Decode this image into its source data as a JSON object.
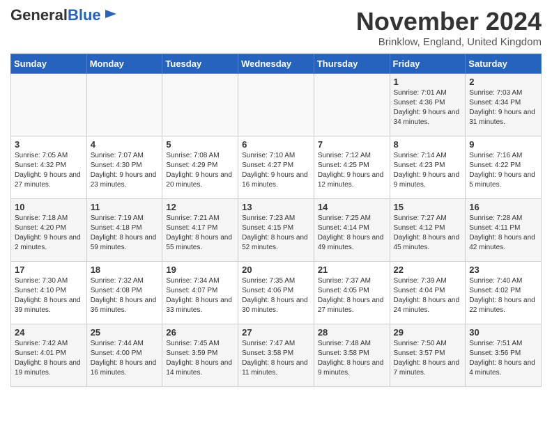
{
  "header": {
    "logo_general": "General",
    "logo_blue": "Blue",
    "month_title": "November 2024",
    "location": "Brinklow, England, United Kingdom"
  },
  "days_of_week": [
    "Sunday",
    "Monday",
    "Tuesday",
    "Wednesday",
    "Thursday",
    "Friday",
    "Saturday"
  ],
  "weeks": [
    [
      {
        "day": "",
        "info": ""
      },
      {
        "day": "",
        "info": ""
      },
      {
        "day": "",
        "info": ""
      },
      {
        "day": "",
        "info": ""
      },
      {
        "day": "",
        "info": ""
      },
      {
        "day": "1",
        "info": "Sunrise: 7:01 AM\nSunset: 4:36 PM\nDaylight: 9 hours and 34 minutes."
      },
      {
        "day": "2",
        "info": "Sunrise: 7:03 AM\nSunset: 4:34 PM\nDaylight: 9 hours and 31 minutes."
      }
    ],
    [
      {
        "day": "3",
        "info": "Sunrise: 7:05 AM\nSunset: 4:32 PM\nDaylight: 9 hours and 27 minutes."
      },
      {
        "day": "4",
        "info": "Sunrise: 7:07 AM\nSunset: 4:30 PM\nDaylight: 9 hours and 23 minutes."
      },
      {
        "day": "5",
        "info": "Sunrise: 7:08 AM\nSunset: 4:29 PM\nDaylight: 9 hours and 20 minutes."
      },
      {
        "day": "6",
        "info": "Sunrise: 7:10 AM\nSunset: 4:27 PM\nDaylight: 9 hours and 16 minutes."
      },
      {
        "day": "7",
        "info": "Sunrise: 7:12 AM\nSunset: 4:25 PM\nDaylight: 9 hours and 12 minutes."
      },
      {
        "day": "8",
        "info": "Sunrise: 7:14 AM\nSunset: 4:23 PM\nDaylight: 9 hours and 9 minutes."
      },
      {
        "day": "9",
        "info": "Sunrise: 7:16 AM\nSunset: 4:22 PM\nDaylight: 9 hours and 5 minutes."
      }
    ],
    [
      {
        "day": "10",
        "info": "Sunrise: 7:18 AM\nSunset: 4:20 PM\nDaylight: 9 hours and 2 minutes."
      },
      {
        "day": "11",
        "info": "Sunrise: 7:19 AM\nSunset: 4:18 PM\nDaylight: 8 hours and 59 minutes."
      },
      {
        "day": "12",
        "info": "Sunrise: 7:21 AM\nSunset: 4:17 PM\nDaylight: 8 hours and 55 minutes."
      },
      {
        "day": "13",
        "info": "Sunrise: 7:23 AM\nSunset: 4:15 PM\nDaylight: 8 hours and 52 minutes."
      },
      {
        "day": "14",
        "info": "Sunrise: 7:25 AM\nSunset: 4:14 PM\nDaylight: 8 hours and 49 minutes."
      },
      {
        "day": "15",
        "info": "Sunrise: 7:27 AM\nSunset: 4:12 PM\nDaylight: 8 hours and 45 minutes."
      },
      {
        "day": "16",
        "info": "Sunrise: 7:28 AM\nSunset: 4:11 PM\nDaylight: 8 hours and 42 minutes."
      }
    ],
    [
      {
        "day": "17",
        "info": "Sunrise: 7:30 AM\nSunset: 4:10 PM\nDaylight: 8 hours and 39 minutes."
      },
      {
        "day": "18",
        "info": "Sunrise: 7:32 AM\nSunset: 4:08 PM\nDaylight: 8 hours and 36 minutes."
      },
      {
        "day": "19",
        "info": "Sunrise: 7:34 AM\nSunset: 4:07 PM\nDaylight: 8 hours and 33 minutes."
      },
      {
        "day": "20",
        "info": "Sunrise: 7:35 AM\nSunset: 4:06 PM\nDaylight: 8 hours and 30 minutes."
      },
      {
        "day": "21",
        "info": "Sunrise: 7:37 AM\nSunset: 4:05 PM\nDaylight: 8 hours and 27 minutes."
      },
      {
        "day": "22",
        "info": "Sunrise: 7:39 AM\nSunset: 4:04 PM\nDaylight: 8 hours and 24 minutes."
      },
      {
        "day": "23",
        "info": "Sunrise: 7:40 AM\nSunset: 4:02 PM\nDaylight: 8 hours and 22 minutes."
      }
    ],
    [
      {
        "day": "24",
        "info": "Sunrise: 7:42 AM\nSunset: 4:01 PM\nDaylight: 8 hours and 19 minutes."
      },
      {
        "day": "25",
        "info": "Sunrise: 7:44 AM\nSunset: 4:00 PM\nDaylight: 8 hours and 16 minutes."
      },
      {
        "day": "26",
        "info": "Sunrise: 7:45 AM\nSunset: 3:59 PM\nDaylight: 8 hours and 14 minutes."
      },
      {
        "day": "27",
        "info": "Sunrise: 7:47 AM\nSunset: 3:58 PM\nDaylight: 8 hours and 11 minutes."
      },
      {
        "day": "28",
        "info": "Sunrise: 7:48 AM\nSunset: 3:58 PM\nDaylight: 8 hours and 9 minutes."
      },
      {
        "day": "29",
        "info": "Sunrise: 7:50 AM\nSunset: 3:57 PM\nDaylight: 8 hours and 7 minutes."
      },
      {
        "day": "30",
        "info": "Sunrise: 7:51 AM\nSunset: 3:56 PM\nDaylight: 8 hours and 4 minutes."
      }
    ]
  ]
}
